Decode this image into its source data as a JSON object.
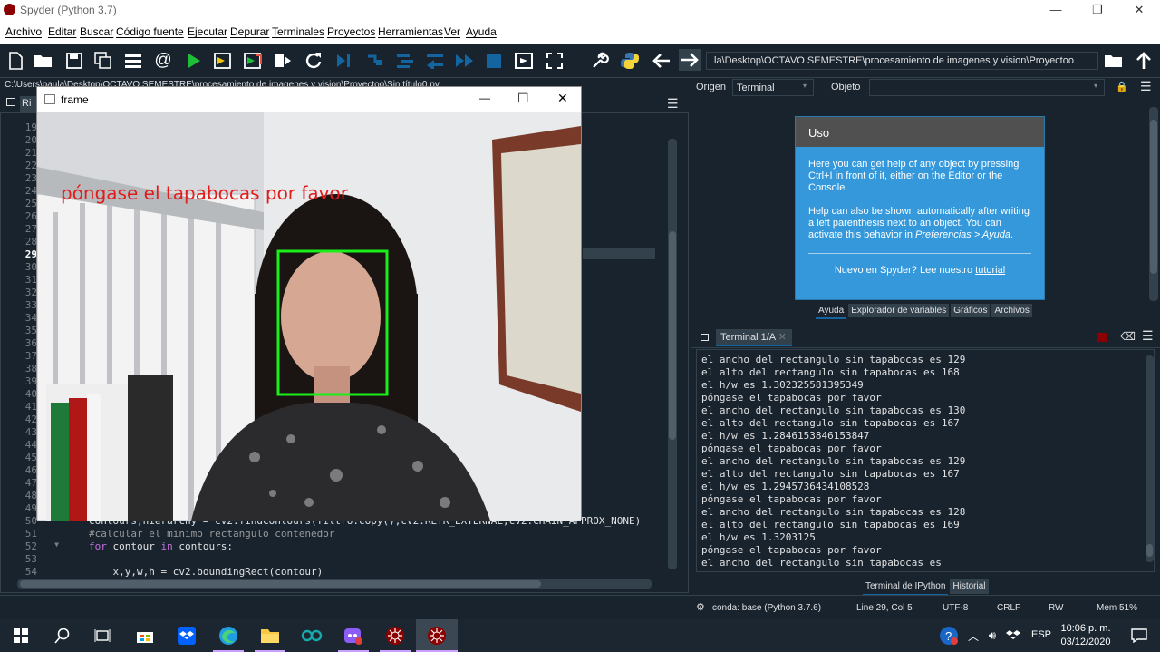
{
  "window": {
    "title": "Spyder (Python 3.7)",
    "minimize": "—",
    "maximize": "❐",
    "close": "✕"
  },
  "menu": [
    "Archivo",
    "Editar",
    "Buscar",
    "Código fuente",
    "Ejecutar",
    "Depurar",
    "Terminales",
    "Proyectos",
    "Herramientas",
    "Ver",
    "Ayuda"
  ],
  "toolbar": {
    "path": "la\\Desktop\\OCTAVO SEMESTRE\\procesamiento de imagenes y vision\\Proyectoo"
  },
  "editor": {
    "path": "C:\\Users\\paula\\Desktop\\OCTAVO SEMESTRE\\procesamiento de imagenes y vision\\Proyectoo\\Sin título0.py",
    "tab_fragment": "Ri",
    "line_numbers": [
      "19",
      "20",
      "21",
      "22",
      "23",
      "24",
      "25",
      "26",
      "27",
      "28",
      "29",
      "30",
      "31",
      "32",
      "33",
      "34",
      "35",
      "36",
      "37",
      "38",
      "39",
      "40",
      "41",
      "42",
      "43",
      "44",
      "45",
      "46",
      "47",
      "48",
      "49",
      "50",
      "51",
      "52",
      "53",
      "54"
    ],
    "current_line": "29",
    "code": [
      {
        "line": "50",
        "text": "contours,hierarchy = cv2.findContours(filtro.copy(),cv2.RETR_EXTERNAL,cv2.CHAIN_APPROX_NONE)"
      },
      {
        "line": "51",
        "text": "#calcular el minimo rectangulo contenedor"
      },
      {
        "line": "52",
        "text": "for contour in contours:"
      },
      {
        "line": "54",
        "text": "    x,y,w,h = cv2.boundingRect(contour)"
      }
    ]
  },
  "frame": {
    "title": "frame",
    "overlay_text": "póngase el tapabocas por favor",
    "minimize": "—",
    "maximize": "☐",
    "close": "✕"
  },
  "help": {
    "origin_label": "Origen",
    "origin_value": "Terminal",
    "object_label": "Objeto",
    "box_title": "Uso",
    "para1": "Here you can get help of any object by pressing Ctrl+I in front of it, either on the Editor or the Console.",
    "para2_a": "Help can also be shown automatically after writing a left parenthesis next to an object. You can activate this behavior in ",
    "para2_link": "Preferencias > Ayuda",
    "para2_b": ".",
    "footer_a": "Nuevo en Spyder? Lee nuestro ",
    "footer_link": "tutorial",
    "tabs": [
      "Ayuda",
      "Explorador de variables",
      "Gráficos",
      "Archivos"
    ]
  },
  "terminal": {
    "tab": "Terminal 1/A",
    "lines": [
      "el ancho del rectangulo sin tapabocas es 129",
      "el alto del rectangulo sin tapabocas es 168",
      "el h/w es 1.302325581395349",
      "póngase el tapabocas por favor",
      "el ancho del rectangulo sin tapabocas es 130",
      "el alto del rectangulo sin tapabocas es 167",
      "el h/w es 1.2846153846153847",
      "póngase el tapabocas por favor",
      "el ancho del rectangulo sin tapabocas es 129",
      "el alto del rectangulo sin tapabocas es 167",
      "el h/w es 1.2945736434108528",
      "póngase el tapabocas por favor",
      "el ancho del rectangulo sin tapabocas es 128",
      "el alto del rectangulo sin tapabocas es 169",
      "el h/w es 1.3203125",
      "póngase el tapabocas por favor",
      "el ancho del rectangulo sin tapabocas es"
    ],
    "tabs": [
      "Terminal de IPython",
      "Historial"
    ]
  },
  "status": {
    "conda": "conda: base (Python 3.7.6)",
    "position": "Line 29, Col 5",
    "encoding": "UTF-8",
    "eol": "CRLF",
    "rw": "RW",
    "mem": "Mem 51%"
  },
  "taskbar": {
    "lang": "ESP",
    "time": "10:06 p. m.",
    "date": "03/12/2020"
  }
}
